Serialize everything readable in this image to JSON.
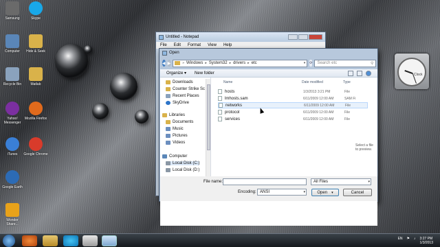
{
  "desktop": {
    "icons": [
      {
        "label": "Samsung",
        "color": "#6a6a6a"
      },
      {
        "label": "Skype",
        "color": "#18a8e8"
      },
      {
        "label": "Computer",
        "color": "#5a86b8"
      },
      {
        "label": "Hide & Seek",
        "color": "#d9b24a"
      },
      {
        "label": "Recycle Bin",
        "color": "#8aa2bd"
      },
      {
        "label": "Matlab",
        "color": "#d9b24a"
      },
      {
        "label": "Yahoo! Messenger",
        "color": "#7b2fa0"
      },
      {
        "label": "Mozilla Firefox",
        "color": "#e06a1c"
      },
      {
        "label": "iTunes",
        "color": "#3a7fd6"
      },
      {
        "label": "Google Chrome",
        "color": "#d83b2b"
      },
      {
        "label": "Google Earth",
        "color": "#2c6bb5"
      },
      {
        "label": "Wonder Share...",
        "color": "#e8a21a"
      }
    ]
  },
  "clock": {
    "label": "Clock"
  },
  "notepad": {
    "title": "Untitled - Notepad",
    "menu": [
      "File",
      "Edit",
      "Format",
      "View",
      "Help"
    ]
  },
  "dialog": {
    "title": "Open",
    "address": [
      "Windows",
      "System32",
      "drivers",
      "etc"
    ],
    "search_placeholder": "Search etc",
    "toolbar": {
      "organize": "Organize ▾",
      "new_folder": "New folder"
    },
    "nav": [
      {
        "label": "Downloads",
        "color": "#d9b24a"
      },
      {
        "label": "Counter Strike Sc",
        "color": "#d9b24a"
      },
      {
        "label": "Recent Places",
        "color": "#8aa2bd"
      },
      {
        "label": "SkyDrive",
        "color": "#2c74c9"
      },
      {
        "label": "Libraries",
        "color": "#d9b24a"
      },
      {
        "label": "Documents",
        "color": "#d9b24a"
      },
      {
        "label": "Music",
        "color": "#6c8fbf"
      },
      {
        "label": "Pictures",
        "color": "#6c8fbf"
      },
      {
        "label": "Videos",
        "color": "#6c8fbf"
      },
      {
        "label": "Computer",
        "color": "#5a86b8"
      },
      {
        "label": "Local Disk (C:)",
        "color": "#8a97a5"
      },
      {
        "label": "Local Disk (D:)",
        "color": "#8a97a5"
      }
    ],
    "columns": {
      "name": "Name",
      "date": "Date modified",
      "type": "Type"
    },
    "files": [
      {
        "name": "hosts",
        "date": "1/3/2013 3:21 PM",
        "type": "File"
      },
      {
        "name": "lmhosts.sam",
        "date": "6/11/2009 12:00 AM",
        "type": "SAM Fi"
      },
      {
        "name": "networks",
        "date": "6/11/2009 12:00 AM",
        "type": "File"
      },
      {
        "name": "protocol",
        "date": "6/11/2009 12:00 AM",
        "type": "File"
      },
      {
        "name": "services",
        "date": "6/11/2009 12:00 AM",
        "type": "File"
      }
    ],
    "preview_text": "Select a file to preview.",
    "file_name_label": "File name:",
    "file_name_value": "",
    "file_type_value": "All Files",
    "encoding_label": "Encoding:",
    "encoding_value": "ANSI",
    "open_label": "Open",
    "cancel_label": "Cancel"
  },
  "taskbar": {
    "tray_lang": "EN",
    "tray_time": "3:27 PM",
    "tray_date": "1/3/2013"
  }
}
